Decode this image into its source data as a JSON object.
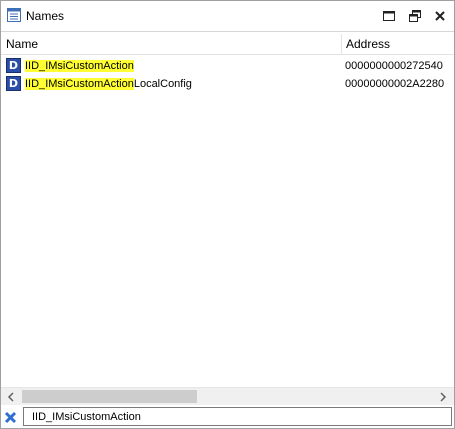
{
  "window": {
    "title": "Names",
    "icons": {
      "title_icon": "list-window-icon",
      "maximize": "maximize-icon",
      "restore": "restore-icon",
      "close": "close-icon"
    }
  },
  "table": {
    "columns": [
      "Name",
      "Address"
    ],
    "rows": [
      {
        "type_badge": "D",
        "name_highlight_prefix": "IID_",
        "name_highlight": "IMsiCustomAction",
        "name_rest": "",
        "address": "0000000000272540"
      },
      {
        "type_badge": "D",
        "name_highlight_prefix": "IID_",
        "name_highlight": "IMsiCustomAction",
        "name_rest": "LocalConfig",
        "address": "00000000002A2280"
      }
    ],
    "highlight_color": "#ffff33",
    "badge_color": "#2b4ea8"
  },
  "filter": {
    "value": "IID_IMsiCustomAction",
    "clear_icon": "clear-filter-icon"
  }
}
